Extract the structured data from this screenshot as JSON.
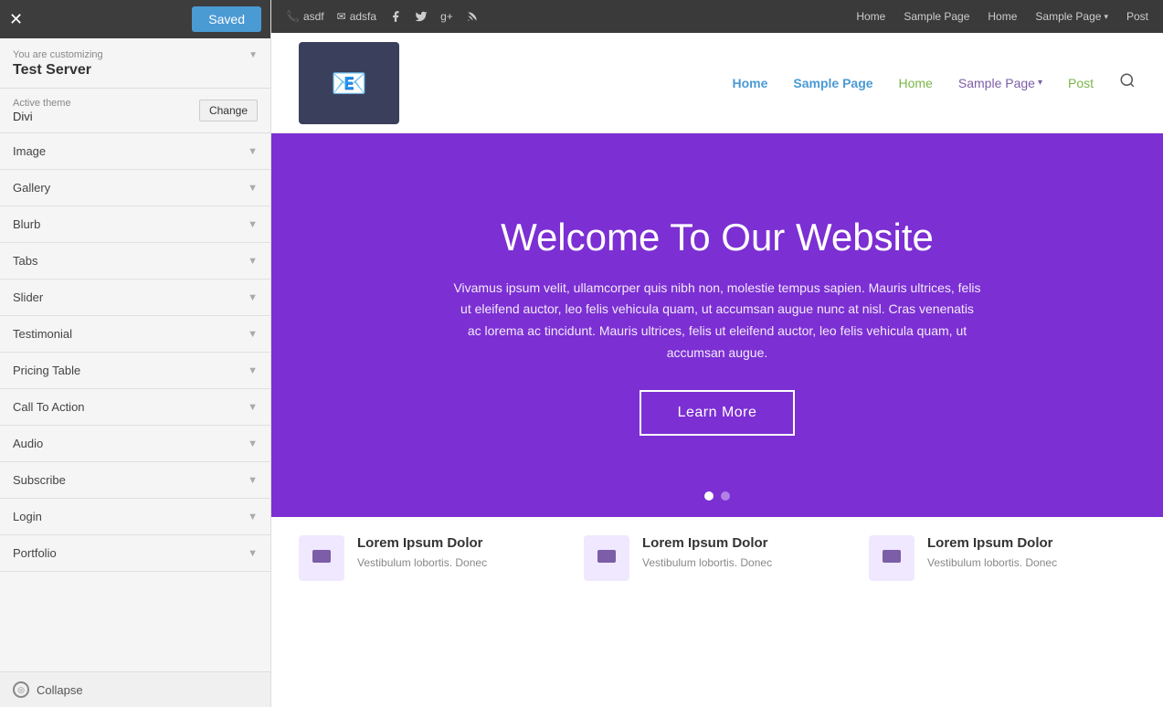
{
  "panel": {
    "close_icon": "✕",
    "saved_label": "Saved",
    "customizing_label": "You are customizing",
    "site_name": "Test Server",
    "theme_label": "Active theme",
    "theme_name": "Divi",
    "change_button": "Change",
    "collapse_label": "Collapse",
    "menu_items": [
      {
        "label": "Image"
      },
      {
        "label": "Gallery"
      },
      {
        "label": "Blurb"
      },
      {
        "label": "Tabs"
      },
      {
        "label": "Slider"
      },
      {
        "label": "Testimonial"
      },
      {
        "label": "Pricing Table"
      },
      {
        "label": "Call To Action"
      },
      {
        "label": "Audio"
      },
      {
        "label": "Subscribe"
      },
      {
        "label": "Login"
      },
      {
        "label": "Portfolio"
      }
    ]
  },
  "top_nav": {
    "phone_icon": "📞",
    "phone_text": "asdf",
    "email_icon": "✉",
    "email_text": "adsfa",
    "facebook_icon": "f",
    "twitter_icon": "t",
    "gplus_icon": "g+",
    "rss_icon": "rss",
    "links": [
      {
        "label": "Home",
        "has_dropdown": false
      },
      {
        "label": "Sample Page",
        "has_dropdown": false
      },
      {
        "label": "Home",
        "has_dropdown": false
      },
      {
        "label": "Sample Page",
        "has_dropdown": true
      },
      {
        "label": "Post",
        "has_dropdown": false
      }
    ]
  },
  "site_header": {
    "nav_links": [
      {
        "label": "Home",
        "style": "green"
      },
      {
        "label": "Sample Page",
        "style": "blue-active"
      },
      {
        "label": "Home",
        "style": "green"
      },
      {
        "label": "Sample Page",
        "style": "purple",
        "has_dropdown": true
      },
      {
        "label": "Post",
        "style": "green"
      }
    ]
  },
  "hero": {
    "title": "Welcome To Our Website",
    "text": "Vivamus ipsum velit, ullamcorper quis nibh non, molestie tempus sapien. Mauris ultrices, felis ut eleifend auctor, leo felis vehicula quam, ut accumsan augue nunc at nisl. Cras venenatis ac lorema ac tincidunt. Mauris ultrices, felis ut eleifend auctor, leo felis vehicula quam, ut accumsan augue.",
    "button_label": "Learn More",
    "dots": [
      {
        "active": true
      },
      {
        "active": false
      }
    ]
  },
  "cards": [
    {
      "title": "Lorem Ipsum Dolor",
      "description": "Vestibulum lobortis. Donec"
    },
    {
      "title": "Lorem Ipsum Dolor",
      "description": "Vestibulum lobortis. Donec"
    },
    {
      "title": "Lorem Ipsum Dolor",
      "description": "Vestibulum lobortis. Donec"
    }
  ]
}
